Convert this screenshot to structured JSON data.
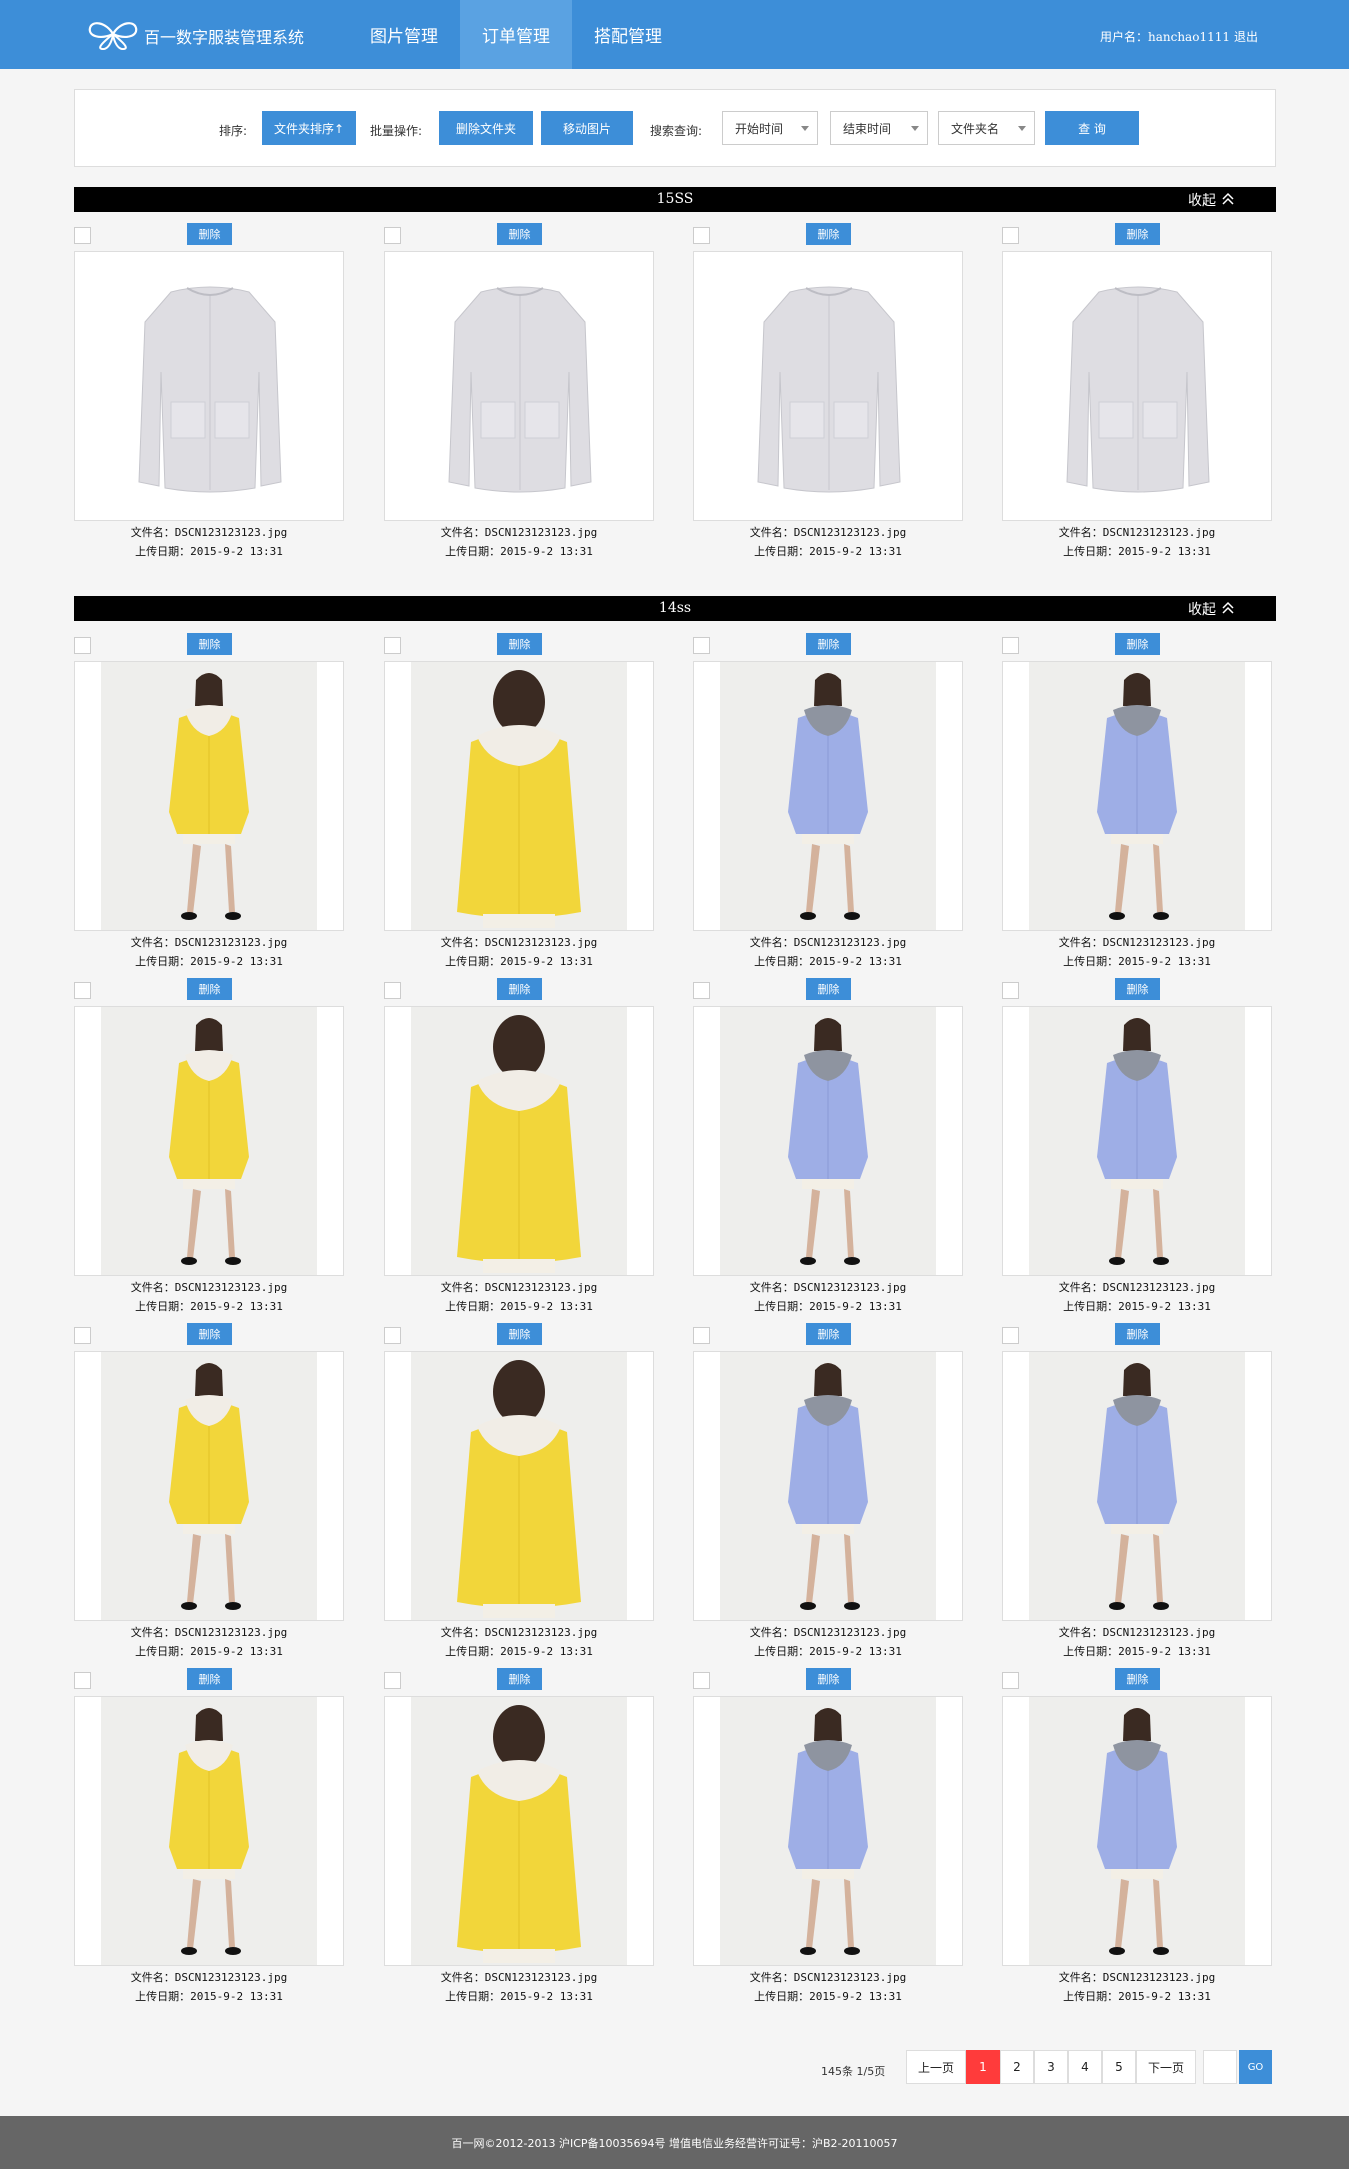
{
  "header": {
    "brand": "百一数字服装管理系统",
    "nav": [
      "图片管理",
      "订单管理",
      "搭配管理"
    ],
    "active_nav": 1,
    "user_label": "用户名：hanchao1111",
    "logout": "退出"
  },
  "toolbar": {
    "sort_label": "排序:",
    "sort_button": "文件夹排序↑",
    "batch_label": "批量操作:",
    "delete_folder": "删除文件夹",
    "move_image": "移动图片",
    "search_label": "搜索查询:",
    "start_time": "开始时间",
    "end_time": "结束时间",
    "folder_name": "文件夹名",
    "query": "查 询"
  },
  "sections": [
    {
      "title": "15SS",
      "collapse": "收起",
      "items": [
        {
          "delete": "删除",
          "filename": "文件名：DSCN123123123.jpg",
          "date": "上传日期：2015-9-2 13:31",
          "image": "coat-white"
        },
        {
          "delete": "删除",
          "filename": "文件名：DSCN123123123.jpg",
          "date": "上传日期：2015-9-2 13:31",
          "image": "coat-white"
        },
        {
          "delete": "删除",
          "filename": "文件名：DSCN123123123.jpg",
          "date": "上传日期：2015-9-2 13:31",
          "image": "coat-white"
        },
        {
          "delete": "删除",
          "filename": "文件名：DSCN123123123.jpg",
          "date": "上传日期：2015-9-2 13:31",
          "image": "coat-white"
        }
      ]
    },
    {
      "title": "14ss",
      "collapse": "收起",
      "items": [
        {
          "delete": "删除",
          "filename": "文件名：DSCN123123123.jpg",
          "date": "上传日期：2015-9-2 13:31",
          "image": "yellow-front"
        },
        {
          "delete": "删除",
          "filename": "文件名：DSCN123123123.jpg",
          "date": "上传日期：2015-9-2 13:31",
          "image": "yellow-back"
        },
        {
          "delete": "删除",
          "filename": "文件名：DSCN123123123.jpg",
          "date": "上传日期：2015-9-2 13:31",
          "image": "blue-front"
        },
        {
          "delete": "删除",
          "filename": "文件名：DSCN123123123.jpg",
          "date": "上传日期：2015-9-2 13:31",
          "image": "blue-front-2"
        },
        {
          "delete": "删除",
          "filename": "文件名：DSCN123123123.jpg",
          "date": "上传日期：2015-9-2 13:31",
          "image": "yellow-front"
        },
        {
          "delete": "删除",
          "filename": "文件名：DSCN123123123.jpg",
          "date": "上传日期：2015-9-2 13:31",
          "image": "yellow-back"
        },
        {
          "delete": "删除",
          "filename": "文件名：DSCN123123123.jpg",
          "date": "上传日期：2015-9-2 13:31",
          "image": "blue-front"
        },
        {
          "delete": "删除",
          "filename": "文件名：DSCN123123123.jpg",
          "date": "上传日期：2015-9-2 13:31",
          "image": "blue-front-2"
        },
        {
          "delete": "删除",
          "filename": "文件名：DSCN123123123.jpg",
          "date": "上传日期：2015-9-2 13:31",
          "image": "yellow-front"
        },
        {
          "delete": "删除",
          "filename": "文件名：DSCN123123123.jpg",
          "date": "上传日期：2015-9-2 13:31",
          "image": "yellow-back"
        },
        {
          "delete": "删除",
          "filename": "文件名：DSCN123123123.jpg",
          "date": "上传日期：2015-9-2 13:31",
          "image": "blue-front"
        },
        {
          "delete": "删除",
          "filename": "文件名：DSCN123123123.jpg",
          "date": "上传日期：2015-9-2 13:31",
          "image": "blue-front-2"
        },
        {
          "delete": "删除",
          "filename": "文件名：DSCN123123123.jpg",
          "date": "上传日期：2015-9-2 13:31",
          "image": "yellow-front"
        },
        {
          "delete": "删除",
          "filename": "文件名：DSCN123123123.jpg",
          "date": "上传日期：2015-9-2 13:31",
          "image": "yellow-back"
        },
        {
          "delete": "删除",
          "filename": "文件名：DSCN123123123.jpg",
          "date": "上传日期：2015-9-2 13:31",
          "image": "blue-front"
        },
        {
          "delete": "删除",
          "filename": "文件名：DSCN123123123.jpg",
          "date": "上传日期：2015-9-2 13:31",
          "image": "blue-front-2"
        }
      ]
    }
  ],
  "pagination": {
    "info": "145条 1/5页",
    "prev": "上一页",
    "pages": [
      "1",
      "2",
      "3",
      "4",
      "5"
    ],
    "current": "1",
    "next": "下一页",
    "go": "GO"
  },
  "footer": "百一网©2012-2013 沪ICP备10035694号 增值电信业务经营许可证号：沪B2-20110057",
  "colors": {
    "primary": "#3d8ed8",
    "active_page": "#ff3b3b",
    "section_bar": "#000000",
    "footer": "#666666"
  }
}
